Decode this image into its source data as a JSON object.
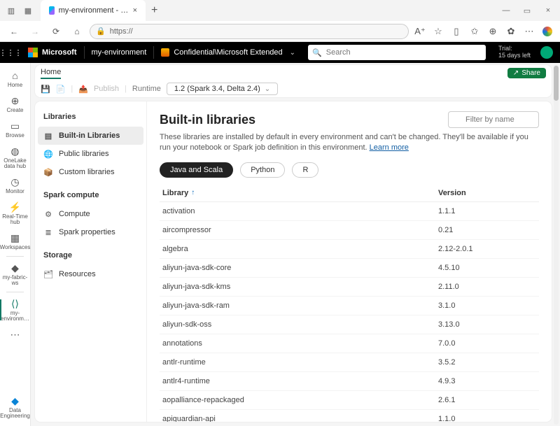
{
  "browser": {
    "tab_title": "my-environment - Synapse Data ",
    "url": "https://",
    "minimize": "—",
    "maximize": "▭",
    "close": "×",
    "newtab": "+"
  },
  "suite": {
    "microsoft": "Microsoft",
    "workspace": "my-environment",
    "sensitivity": "Confidential\\Microsoft Extended",
    "search_placeholder": "Search",
    "trial_label": "Trial:",
    "trial_days": "15 days left"
  },
  "rail": {
    "items": [
      {
        "label": "Home"
      },
      {
        "label": "Create"
      },
      {
        "label": "Browse"
      },
      {
        "label": "OneLake data hub"
      },
      {
        "label": "Monitor"
      },
      {
        "label": "Real-Time hub"
      },
      {
        "label": "Workspaces"
      },
      {
        "label": "my-fabric-ws"
      },
      {
        "label": "my-environm…"
      }
    ],
    "bottom_label": "Data Engineering"
  },
  "header": {
    "crumb": "Home",
    "share": "Share",
    "publish": "Publish",
    "runtime_label": "Runtime",
    "runtime_value": "1.2 (Spark 3.4, Delta 2.4)"
  },
  "cardnav": {
    "group1": "Libraries",
    "items1": [
      "Built-in Libraries",
      "Public libraries",
      "Custom libraries"
    ],
    "group2": "Spark compute",
    "items2": [
      "Compute",
      "Spark properties"
    ],
    "group3": "Storage",
    "items3": [
      "Resources"
    ]
  },
  "main": {
    "title": "Built-in libraries",
    "description": "These libraries are installed by default in every environment and can't be changed. They'll be available if you run your notebook or Spark job definition in this environment. ",
    "learn_more": "Learn more",
    "filter_placeholder": "Filter by name",
    "pills": [
      "Java and Scala",
      "Python",
      "R"
    ],
    "col_library": "Library",
    "col_version": "Version",
    "rows": [
      {
        "lib": "activation",
        "ver": "1.1.1"
      },
      {
        "lib": "aircompressor",
        "ver": "0.21"
      },
      {
        "lib": "algebra",
        "ver": "2.12-2.0.1"
      },
      {
        "lib": "aliyun-java-sdk-core",
        "ver": "4.5.10"
      },
      {
        "lib": "aliyun-java-sdk-kms",
        "ver": "2.11.0"
      },
      {
        "lib": "aliyun-java-sdk-ram",
        "ver": "3.1.0"
      },
      {
        "lib": "aliyun-sdk-oss",
        "ver": "3.13.0"
      },
      {
        "lib": "annotations",
        "ver": "7.0.0"
      },
      {
        "lib": "antlr-runtime",
        "ver": "3.5.2"
      },
      {
        "lib": "antlr4-runtime",
        "ver": "4.9.3"
      },
      {
        "lib": "aopalliance-repackaged",
        "ver": "2.6.1"
      },
      {
        "lib": "apiguardian-api",
        "ver": "1.1.0"
      }
    ]
  }
}
